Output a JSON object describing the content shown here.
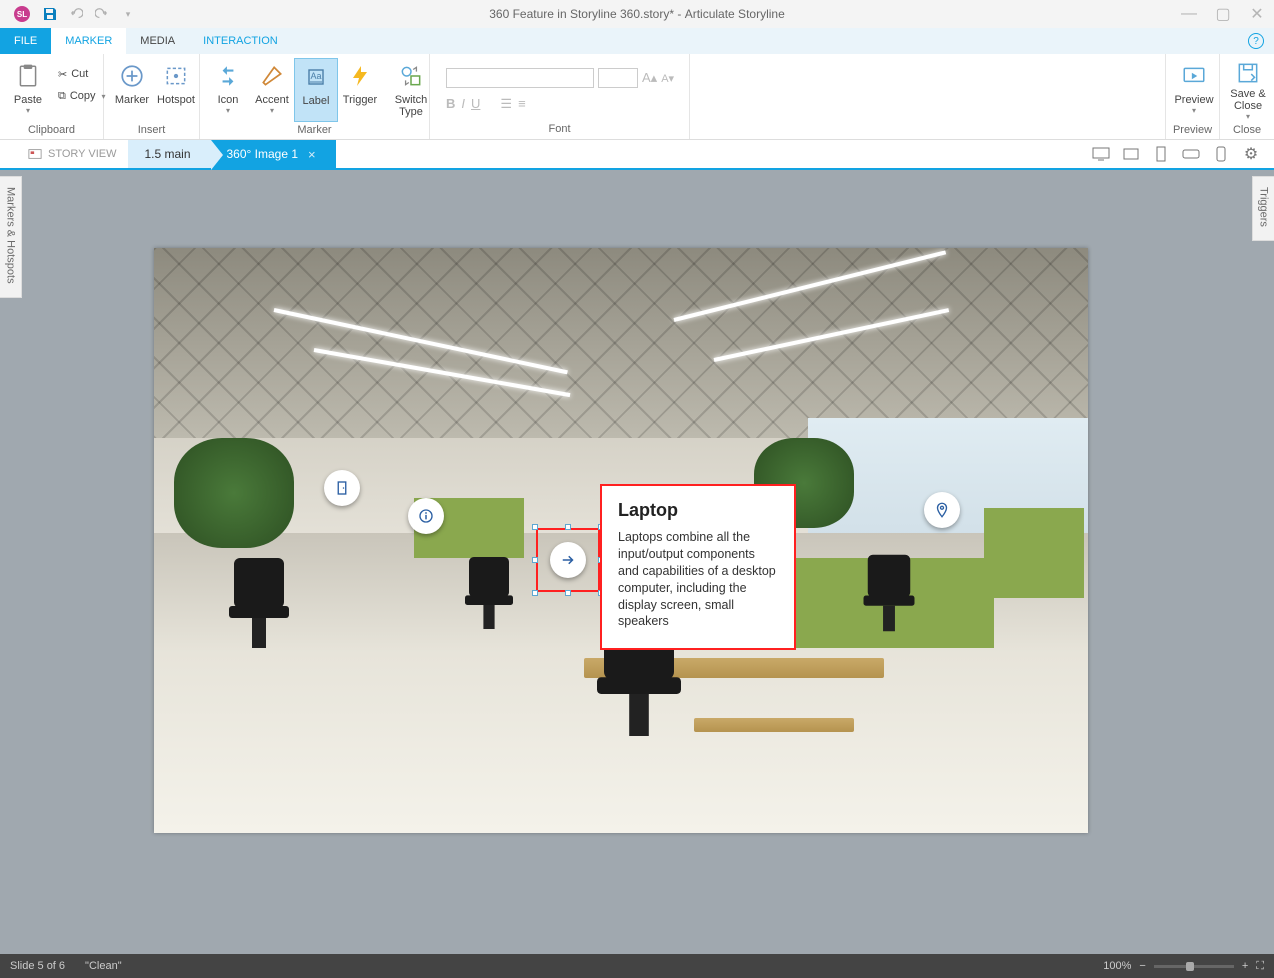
{
  "titlebar": {
    "document_title": "360 Feature in Storyline 360.story* -",
    "app_name": "Articulate Storyline"
  },
  "tabs": {
    "file": "FILE",
    "marker": "MARKER",
    "media": "MEDIA",
    "interaction": "INTERACTION"
  },
  "ribbon": {
    "clipboard": {
      "paste": "Paste",
      "cut": "Cut",
      "copy": "Copy",
      "group": "Clipboard"
    },
    "insert": {
      "marker": "Marker",
      "hotspot": "Hotspot",
      "group": "Insert"
    },
    "marker_grp": {
      "icon": "Icon",
      "accent": "Accent",
      "label": "Label",
      "trigger": "Trigger",
      "switch": "Switch Type",
      "group": "Marker"
    },
    "font": {
      "group": "Font"
    },
    "preview": {
      "preview": "Preview",
      "group": "Preview"
    },
    "close": {
      "save": "Save & Close",
      "group": "Close"
    }
  },
  "secondary": {
    "story_view": "STORY VIEW",
    "crumb1": "1.5 main",
    "crumb2": "360° Image 1"
  },
  "panels": {
    "left": "Markers & Hotspots",
    "right": "Triggers"
  },
  "label_card": {
    "title": "Laptop",
    "body": "Laptops combine all the input/output components and capabilities of a desktop computer, including the display screen, small speakers"
  },
  "statusbar": {
    "slide": "Slide 5 of 6",
    "layout": "\"Clean\"",
    "zoom": "100%"
  }
}
